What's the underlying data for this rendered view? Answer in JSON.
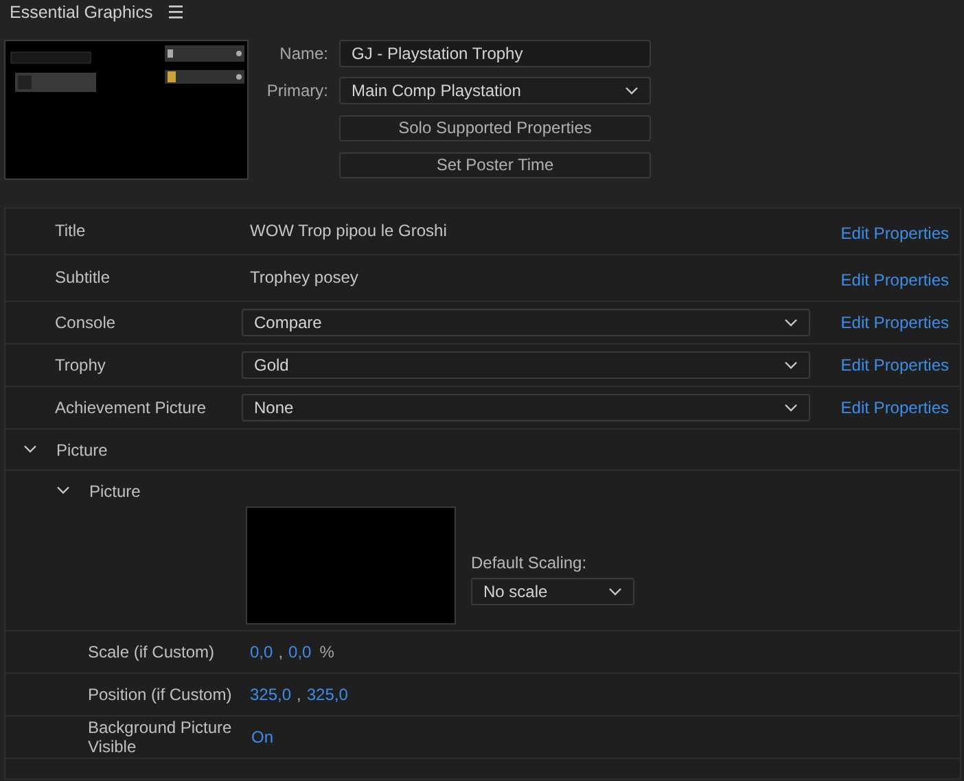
{
  "panel": {
    "title": "Essential Graphics"
  },
  "template": {
    "name_label": "Name:",
    "name": "GJ - Playstation Trophy",
    "primary_label": "Primary:",
    "primary": "Main Comp Playstation",
    "buttons": [
      "Solo Supported Properties",
      "Set Poster Time"
    ]
  },
  "properties": [
    {
      "kind": "text",
      "label": "Title",
      "value": "WOW Trop pipou le Groshi",
      "link": "Edit Properties"
    },
    {
      "kind": "text",
      "label": "Subtitle",
      "value": "Trophey posey",
      "link": "Edit Properties"
    },
    {
      "kind": "dropdown",
      "label": "Console",
      "value": "Compare",
      "link": "Edit Properties"
    },
    {
      "kind": "dropdown",
      "label": "Trophy",
      "value": "Gold",
      "link": "Edit Properties"
    },
    {
      "kind": "dropdown",
      "label": "Achievement Picture",
      "value": "None",
      "link": "Edit Properties"
    },
    {
      "kind": "group",
      "label": "Picture",
      "expanded": true,
      "children": [
        {
          "kind": "group",
          "label": "Picture",
          "expanded": true,
          "children": [
            {
              "scaling_label": "Default Scaling:",
              "scaling": "No scale"
            },
            {
              "kind": "pair",
              "label": "Scale (if Custom)",
              "values": [
                "0,0",
                "0,0"
              ],
              "separator": ",",
              "unit": "%"
            },
            {
              "kind": "pair",
              "label": "Position (if Custom)",
              "values": [
                "325,0",
                "325,0"
              ],
              "separator": ","
            },
            {
              "kind": "toggle",
              "label": "Background Picture Visible",
              "value": "On"
            }
          ]
        }
      ]
    }
  ]
}
